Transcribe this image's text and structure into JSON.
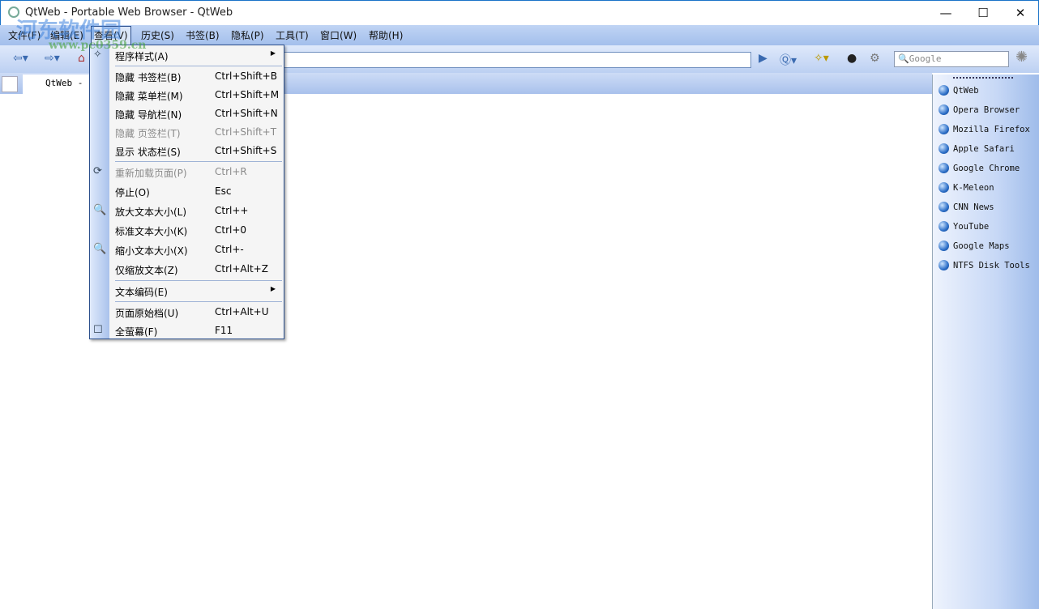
{
  "window": {
    "title": "QtWeb - Portable Web Browser - QtWeb",
    "minimize": "—",
    "maximize": "☐",
    "close": "✕"
  },
  "menubar": [
    "文件(F)",
    "编辑(E)",
    "查看(V)",
    "历史(S)",
    "书签(B)",
    "隐私(P)",
    "工具(T)",
    "窗口(W)",
    "帮助(H)"
  ],
  "toolbar": {
    "search_placeholder": "Google",
    "address": ""
  },
  "tab": {
    "label": "QtWeb - P"
  },
  "view_menu": [
    {
      "label": "程序样式(A)",
      "shortcut": "",
      "submenu": true,
      "icon": "magic-wand-icon"
    },
    {
      "sep": true
    },
    {
      "label": "隐藏 书签栏(B)",
      "shortcut": "Ctrl+Shift+B"
    },
    {
      "label": "隐藏 菜单栏(M)",
      "shortcut": "Ctrl+Shift+M"
    },
    {
      "label": "隐藏 导航栏(N)",
      "shortcut": "Ctrl+Shift+N"
    },
    {
      "label": "隐藏 页签栏(T)",
      "shortcut": "Ctrl+Shift+T",
      "disabled": true
    },
    {
      "label": "显示 状态栏(S)",
      "shortcut": "Ctrl+Shift+S"
    },
    {
      "sep": true
    },
    {
      "label": "重新加载页面(P)",
      "shortcut": "Ctrl+R",
      "disabled": true,
      "icon": "reload-icon"
    },
    {
      "label": "停止(O)",
      "shortcut": "Esc"
    },
    {
      "label": "放大文本大小(L)",
      "shortcut": "Ctrl++",
      "icon": "zoom-in-icon"
    },
    {
      "label": "标准文本大小(K)",
      "shortcut": "Ctrl+0"
    },
    {
      "label": "缩小文本大小(X)",
      "shortcut": "Ctrl+-",
      "icon": "zoom-out-icon"
    },
    {
      "label": "仅缩放文本(Z)",
      "shortcut": "Ctrl+Alt+Z"
    },
    {
      "sep": true
    },
    {
      "label": "文本编码(E)",
      "shortcut": "",
      "submenu": true
    },
    {
      "sep": true
    },
    {
      "label": "页面原始档(U)",
      "shortcut": "Ctrl+Alt+U"
    },
    {
      "label": "全萤幕(F)",
      "shortcut": "F11",
      "icon": "checkbox-icon"
    }
  ],
  "bookmarks": [
    "QtWeb",
    "Opera Browser",
    "Mozilla Firefox",
    "Apple Safari",
    "Google Chrome",
    "K-Meleon",
    "CNN News",
    "YouTube",
    "Google Maps",
    "NTFS Disk Tools"
  ],
  "watermark": {
    "text": "河东软件园",
    "url": "www.pc0359.cn"
  }
}
